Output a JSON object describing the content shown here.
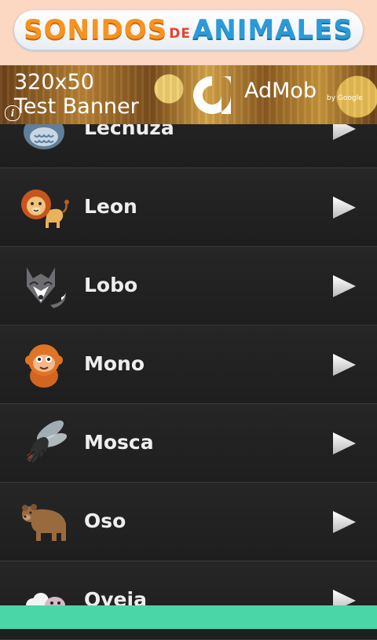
{
  "header": {
    "logo_word1": "SONIDOS",
    "logo_word2": "DE",
    "logo_word3": "ANIMALES",
    "colors": {
      "background": "#fcd7c1",
      "orange": "#f7931e",
      "blue": "#2b9ad8",
      "red": "#e8432e"
    }
  },
  "ad": {
    "line1": "320x50",
    "line2": "Test Banner",
    "brand": "AdMob",
    "by": "by Google",
    "info_icon": "info-icon"
  },
  "animals": [
    {
      "name": "Lechuza",
      "icon": "owl-icon"
    },
    {
      "name": "Leon",
      "icon": "lion-icon"
    },
    {
      "name": "Lobo",
      "icon": "wolf-icon"
    },
    {
      "name": "Mono",
      "icon": "monkey-icon"
    },
    {
      "name": "Mosca",
      "icon": "fly-icon"
    },
    {
      "name": "Oso",
      "icon": "bear-icon"
    },
    {
      "name": "Oveja",
      "icon": "sheep-icon"
    }
  ],
  "play_icon": "play-icon",
  "colors": {
    "list_background": "#222222",
    "text": "#eeeeee",
    "bottom_bar": "#4bd6a7"
  }
}
